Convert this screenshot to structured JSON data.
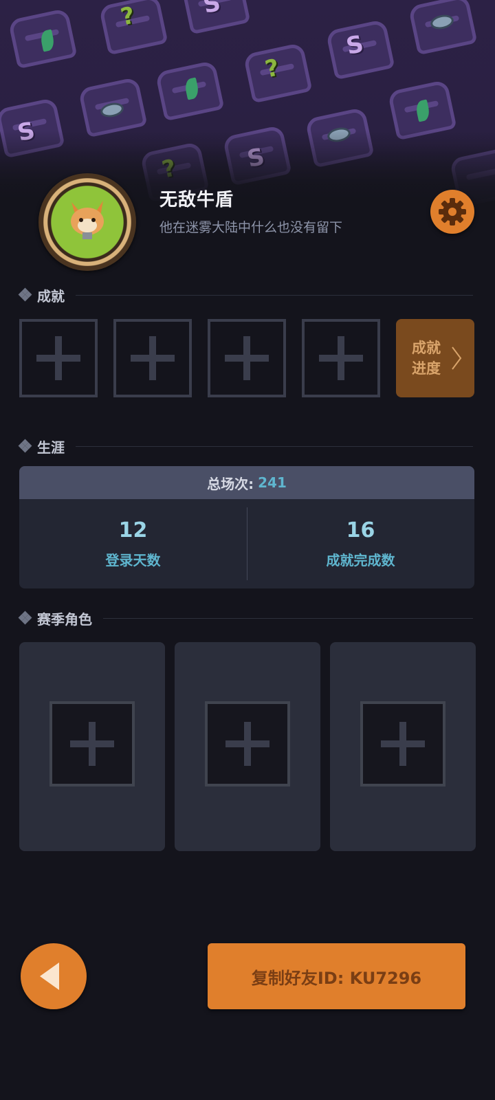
{
  "profile": {
    "name": "无敌牛盾",
    "bio": "他在迷雾大陆中什么也没有留下",
    "avatar_icon": "fox-avatar-icon"
  },
  "sections": {
    "achievements_title": "成就",
    "career_title": "生涯",
    "season_chars_title": "赛季角色"
  },
  "achievements": {
    "slot_count": 4,
    "progress_label": "成就进度"
  },
  "career": {
    "total_label": "总场次:",
    "total_value": "241",
    "stats": [
      {
        "value": "12",
        "label": "登录天数"
      },
      {
        "value": "16",
        "label": "成就完成数"
      }
    ]
  },
  "season_characters": {
    "slot_count": 3
  },
  "actions": {
    "copy_id_label": "复制好友ID: KU7296"
  },
  "colors": {
    "accent_orange": "#e07f2c",
    "banner_purple": "#2c2145",
    "stat_blue": "#5fb6cf"
  }
}
